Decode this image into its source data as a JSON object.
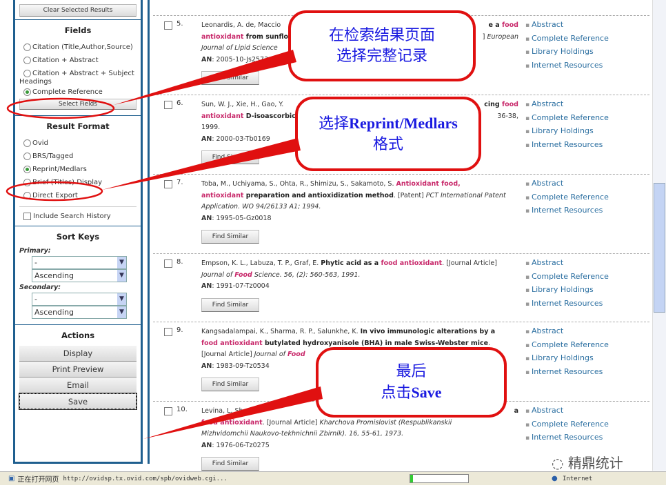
{
  "sidebar": {
    "clear_button": "Clear Selected Results",
    "fields": {
      "title": "Fields",
      "options": [
        {
          "label": "Citation (Title,Author,Source)",
          "checked": false
        },
        {
          "label": "Citation + Abstract",
          "checked": false
        },
        {
          "label": "Citation + Abstract + Subject",
          "checked": false
        }
      ],
      "wrap": "Headings",
      "complete": "Complete Reference",
      "select_button": "Select Fields"
    },
    "format": {
      "title": "Result Format",
      "options": [
        {
          "label": "Ovid",
          "checked": false
        },
        {
          "label": "BRS/Tagged",
          "checked": false
        },
        {
          "label": "Reprint/Medlars",
          "checked": true
        },
        {
          "label": "Brief (Titles) Display",
          "checked": false
        },
        {
          "label": "Direct Export",
          "checked": false
        }
      ],
      "history": "Include Search History"
    },
    "sort": {
      "title": "Sort Keys",
      "primary": "Primary:",
      "secondary": "Secondary:",
      "primary_field": "-",
      "primary_order": "Ascending",
      "secondary_field": "-",
      "secondary_order": "Ascending"
    },
    "actions": {
      "title": "Actions",
      "display": "Display",
      "print": "Print Preview",
      "email": "Email",
      "save": "Save"
    }
  },
  "results": [
    {
      "num": "5.",
      "lines": [
        [
          [
            [
              "Leonardis, A. de, Maccio",
              ""
            ]
          ],
          [
            [
              "e a ",
              "b"
            ],
            [
              "food",
              "h"
            ]
          ]
        ],
        [
          [
            [
              "antioxidant",
              "h"
            ],
            [
              " from sunflo",
              "b"
            ]
          ],
          [
            [
              "] ",
              ""
            ],
            [
              "European",
              "i"
            ]
          ]
        ],
        [
          [
            [
              "Journal of Lipid Science",
              "i"
            ]
          ]
        ]
      ],
      "an": "2005-10-Js2573",
      "find": "Find Similar",
      "links": [
        "Abstract",
        "Complete Reference",
        "Library Holdings",
        "Internet Resources"
      ]
    },
    {
      "num": "6.",
      "lines": [
        [
          [
            [
              "Sun, W. J., Xie, H., Gao, Y.",
              ""
            ]
          ],
          [
            [
              "cing ",
              "b"
            ],
            [
              "food",
              "h"
            ]
          ]
        ],
        [
          [
            [
              "antioxidant",
              "h"
            ],
            [
              " D-isoascorbic",
              "b"
            ]
          ],
          [
            [
              "36-38,",
              ""
            ]
          ]
        ],
        [
          [
            [
              "1999.",
              ""
            ]
          ]
        ]
      ],
      "an": "2000-03-Tb0169",
      "find": "Find Similar",
      "links": [
        "Abstract",
        "Complete Reference",
        "Library Holdings",
        "Internet Resources"
      ]
    },
    {
      "num": "7.",
      "lines": [
        [
          [
            [
              "Toba, M., Uchiyama, S., Ohta, R., Shimizu, S., Sakamoto, S. ",
              ""
            ],
            [
              "Antioxidant food,",
              "h"
            ]
          ]
        ],
        [
          [
            [
              "antioxidant",
              "h"
            ],
            [
              " preparation and antioxidization method",
              "b"
            ],
            [
              ". [Patent] ",
              ""
            ],
            [
              "PCT International Patent",
              "i"
            ]
          ]
        ],
        [
          [
            [
              "Application. WO 94/26133 A1; 1994.",
              "i"
            ]
          ]
        ]
      ],
      "an": "1995-05-Gz0018",
      "find": "Find Similar",
      "links": [
        "Abstract",
        "Complete Reference",
        "Internet Resources"
      ]
    },
    {
      "num": "8.",
      "lines": [
        [
          [
            [
              "Empson, K. L., Labuza, T. P., Graf, E. ",
              ""
            ],
            [
              "Phytic acid as a ",
              "b"
            ],
            [
              "food antioxidant",
              "h"
            ],
            [
              ". [Journal Article]",
              ""
            ]
          ]
        ],
        [
          [
            [
              "Journal of ",
              "i"
            ],
            [
              "Food",
              "hi"
            ],
            [
              " Science. 56, (2): 560-563, 1991.",
              "i"
            ]
          ]
        ]
      ],
      "an": "1991-07-Tz0004",
      "find": "Find Similar",
      "links": [
        "Abstract",
        "Complete Reference",
        "Library Holdings",
        "Internet Resources"
      ]
    },
    {
      "num": "9.",
      "lines": [
        [
          [
            [
              "Kangsadalampai, K., Sharma, R. P., Salunkhe, K. ",
              ""
            ],
            [
              "In vivo immunologic alterations by a",
              "b"
            ]
          ]
        ],
        [
          [
            [
              "food antioxidant",
              "h"
            ],
            [
              " butylated hydroxyanisole (BHA) in male Swiss-Webster mice",
              "b"
            ],
            [
              ".",
              ""
            ]
          ]
        ],
        [
          [
            [
              "[Journal Article] ",
              ""
            ],
            [
              "Journal of ",
              "i"
            ],
            [
              "Food",
              "hi"
            ]
          ]
        ]
      ],
      "an": "1983-09-Tz0534",
      "find": "Find Similar",
      "links": [
        "Abstract",
        "Complete Reference",
        "Library Holdings",
        "Internet Resources"
      ]
    },
    {
      "num": "10.",
      "lines": [
        [
          [
            [
              "Levina, L. Sh.",
              ""
            ]
          ],
          [
            [
              "a",
              "b"
            ]
          ]
        ],
        [
          [
            [
              "food antioxidant",
              "h"
            ],
            [
              ". [Journal Article] ",
              ""
            ],
            [
              "Kharchova Promislovist (Respublikanskii",
              "i"
            ]
          ]
        ],
        [
          [
            [
              "Mizhvidomchii Naukovo-tekhnichnii Zbirnik). 16, 55-61, 1973.",
              "i"
            ]
          ]
        ]
      ],
      "an": "1976-06-Tz0275",
      "find": "Find Similar",
      "links": [
        "Abstract",
        "Complete Reference",
        "Internet Resources"
      ]
    }
  ],
  "an_label": "AN",
  "callouts": {
    "c1_line1": "在检索结果页面",
    "c1_line2": "选择完整记录",
    "c2_prefix": "选择",
    "c2_bold": "Reprint/Medlars",
    "c2_line2": "格式",
    "c3_line1": "最后",
    "c3_prefix": "点击",
    "c3_bold": "Save"
  },
  "status": {
    "text": "正在打开网页",
    "url": "http://ovidsp.tx.ovid.com/spb/ovidweb.cgi...",
    "zone": "Internet",
    "progress": 0.05
  },
  "watermark": "精鼎统计",
  "colors": {
    "border": "#1f5f8f",
    "highlight": "#c8286a",
    "link": "#2a6ea0",
    "callout": "#e01010",
    "callout_text": "#1a1ae0"
  }
}
